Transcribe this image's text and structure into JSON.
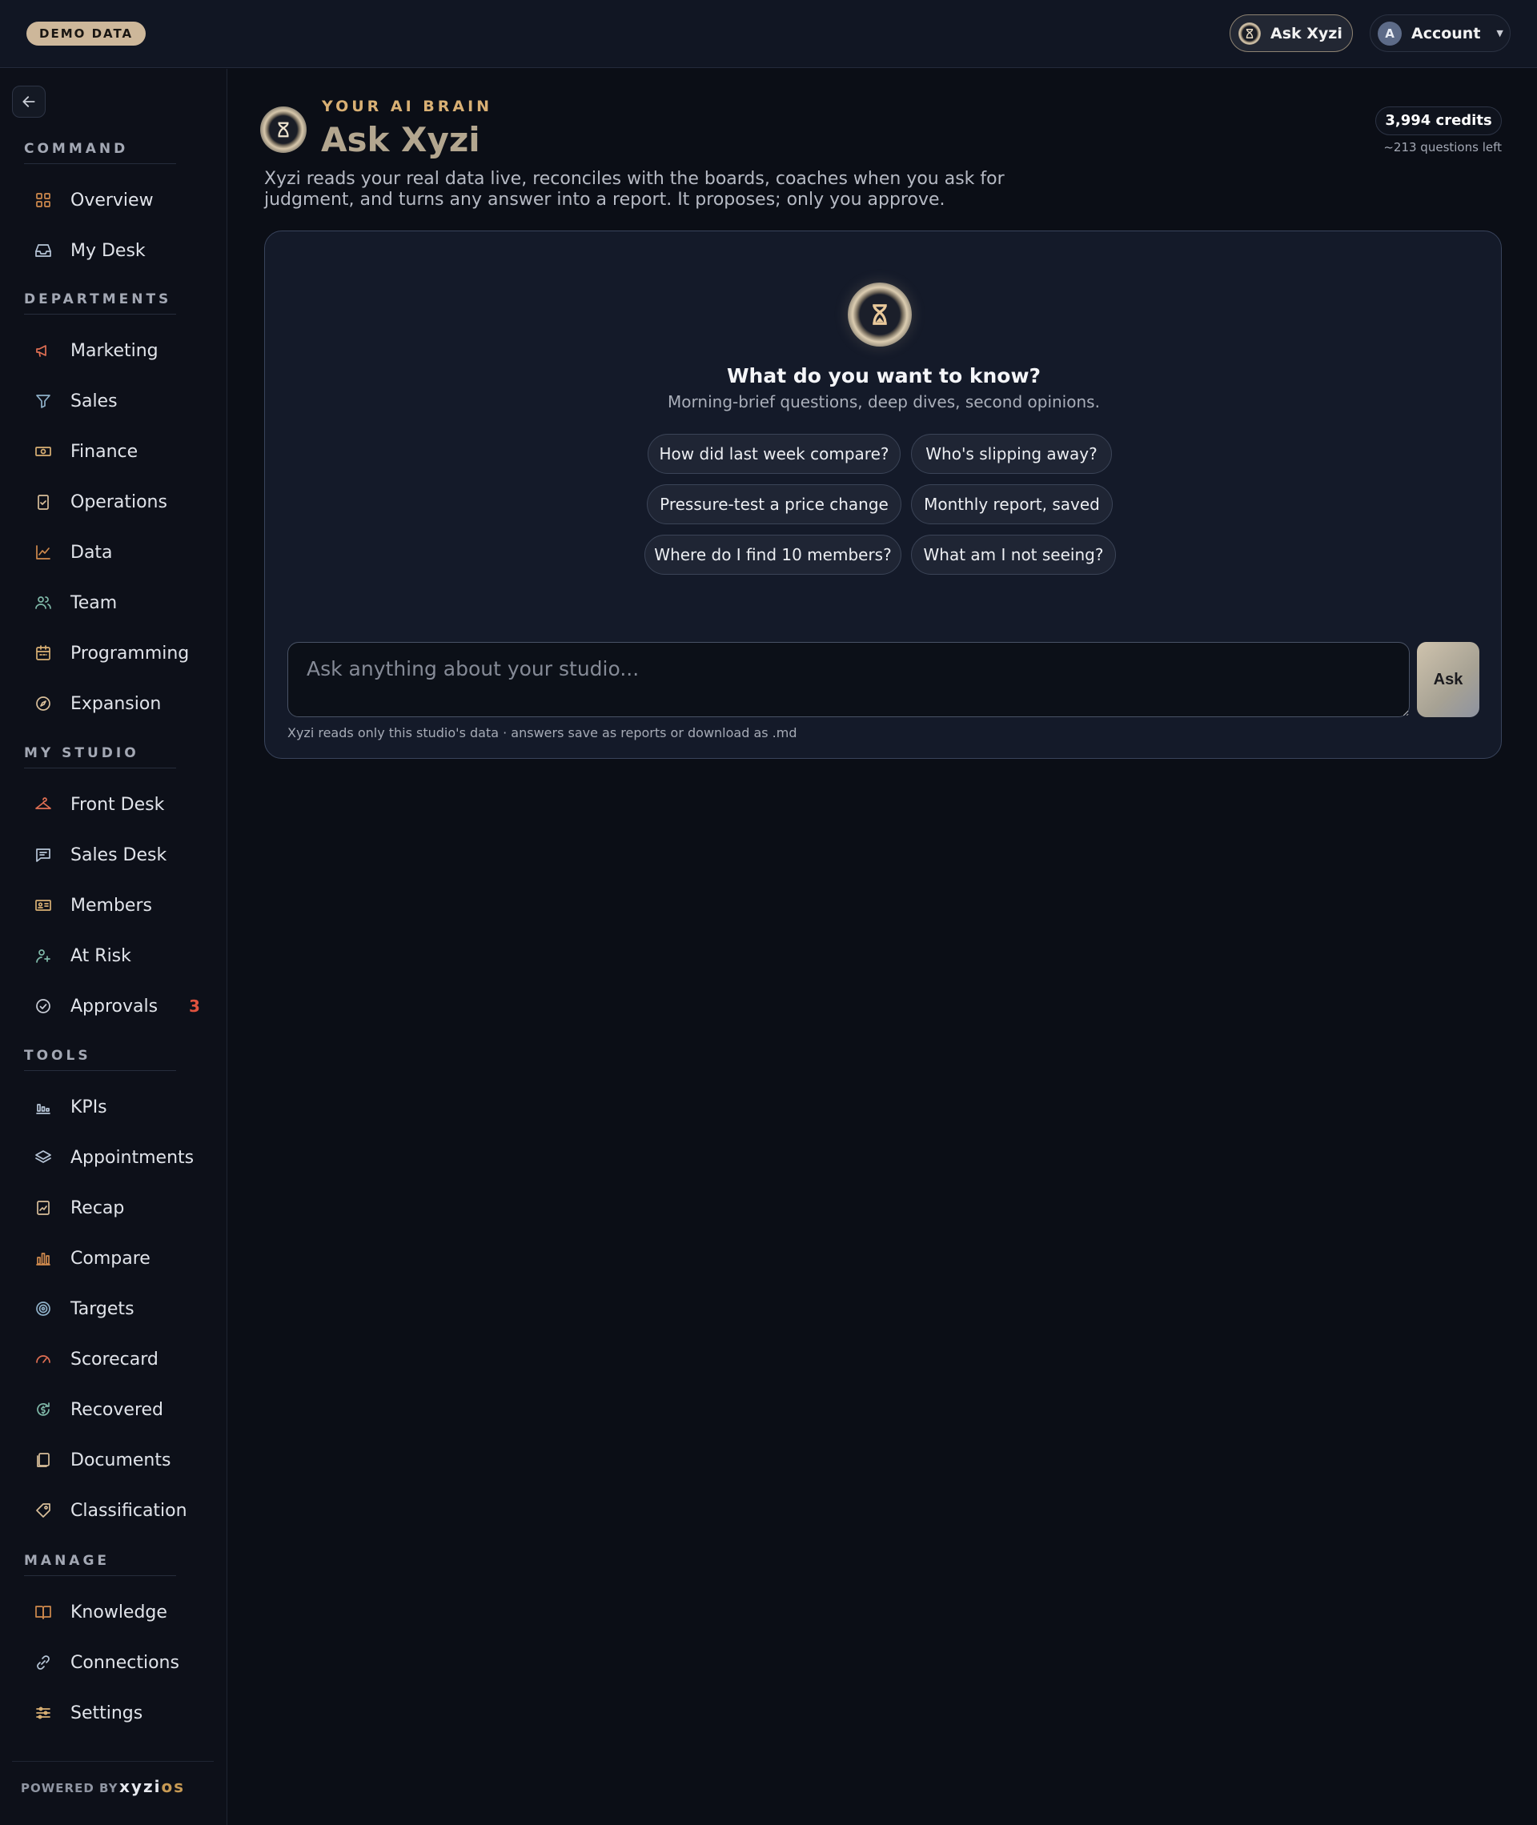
{
  "topbar": {
    "demo_badge": "DEMO DATA",
    "ask_button": "Ask Xyzi",
    "account_initial": "A",
    "account_label": "Account"
  },
  "sidebar": {
    "sections": [
      {
        "label": "COMMAND",
        "items": [
          {
            "label": "Overview",
            "icon": "grid-icon"
          },
          {
            "label": "My Desk",
            "icon": "inbox-icon"
          }
        ]
      },
      {
        "label": "DEPARTMENTS",
        "items": [
          {
            "label": "Marketing",
            "icon": "megaphone-icon"
          },
          {
            "label": "Sales",
            "icon": "funnel-icon"
          },
          {
            "label": "Finance",
            "icon": "banknote-icon"
          },
          {
            "label": "Operations",
            "icon": "clipboard-check-icon"
          },
          {
            "label": "Data",
            "icon": "line-chart-icon"
          },
          {
            "label": "Team",
            "icon": "users-icon"
          },
          {
            "label": "Programming",
            "icon": "calendar-icon"
          },
          {
            "label": "Expansion",
            "icon": "compass-icon"
          }
        ]
      },
      {
        "label": "MY STUDIO",
        "items": [
          {
            "label": "Front Desk",
            "icon": "hanger-icon"
          },
          {
            "label": "Sales Desk",
            "icon": "message-icon"
          },
          {
            "label": "Members",
            "icon": "id-card-icon"
          },
          {
            "label": "At Risk",
            "icon": "user-plus-icon"
          },
          {
            "label": "Approvals",
            "icon": "check-circle-icon",
            "count": "3"
          }
        ]
      },
      {
        "label": "TOOLS",
        "items": [
          {
            "label": "KPIs",
            "icon": "bar-metrics-icon"
          },
          {
            "label": "Appointments",
            "icon": "layers-icon"
          },
          {
            "label": "Recap",
            "icon": "report-icon"
          },
          {
            "label": "Compare",
            "icon": "bar-chart-icon"
          },
          {
            "label": "Targets",
            "icon": "target-icon"
          },
          {
            "label": "Scorecard",
            "icon": "gauge-icon"
          },
          {
            "label": "Recovered",
            "icon": "refresh-dollar-icon"
          },
          {
            "label": "Documents",
            "icon": "files-icon"
          },
          {
            "label": "Classification",
            "icon": "tag-icon"
          }
        ]
      },
      {
        "label": "MANAGE",
        "items": [
          {
            "label": "Knowledge",
            "icon": "book-icon"
          },
          {
            "label": "Connections",
            "icon": "link-icon"
          },
          {
            "label": "Settings",
            "icon": "sliders-icon"
          }
        ]
      }
    ],
    "footer": {
      "powered_by": "POWERED BY",
      "brand_main": "xyzi",
      "brand_accent": "os"
    }
  },
  "main": {
    "eyebrow": "YOUR AI BRAIN",
    "title": "Ask Xyzi",
    "description": "Xyzi reads your real data live, reconciles with the boards, coaches when you ask for judgment, and turns any answer into a report. It proposes; only you approve.",
    "credits": "3,994 credits",
    "credits_sub": "~213 questions left",
    "card": {
      "heading": "What do you want to know?",
      "subheading": "Morning-brief questions, deep dives, second opinions.",
      "suggestions": [
        "How did last week compare?",
        "Who's slipping away?",
        "Pressure-test a price change",
        "Monthly report, saved",
        "Where do I find 10 members?",
        "What am I not seeing?"
      ],
      "input_placeholder": "Ask anything about your studio...",
      "ask_button": "Ask",
      "note": "Xyzi reads only this studio's data · answers save as reports or download as .md"
    }
  },
  "colors": {
    "accent_gold": "#d9b074",
    "count_red": "#e0533f",
    "background": "#0b0e16"
  }
}
